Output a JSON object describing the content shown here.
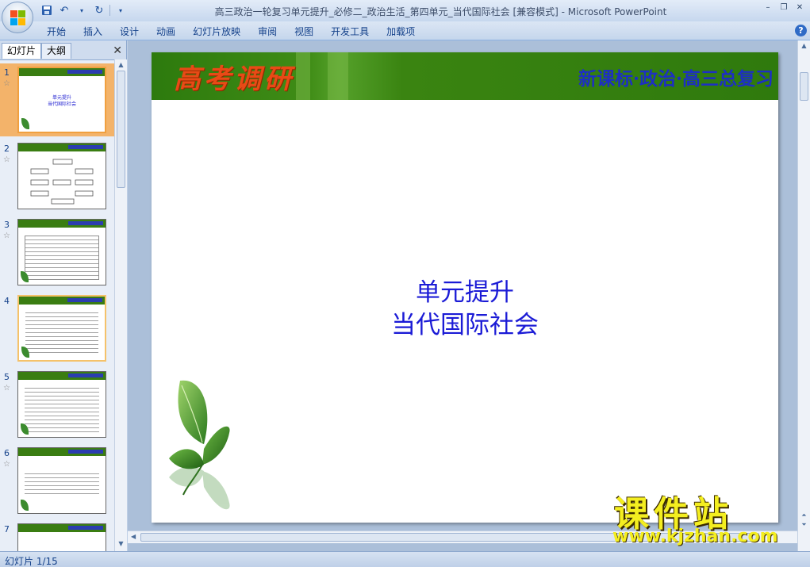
{
  "window": {
    "title": "高三政治一轮复习单元提升_必修二_政治生活_第四单元_当代国际社会 [兼容模式] - Microsoft PowerPoint",
    "minimize": "–",
    "restore": "❐",
    "close": "✕"
  },
  "qat": {
    "save_icon": "save-icon",
    "undo_icon": "undo-icon",
    "redo_icon": "redo-icon"
  },
  "ribbon": {
    "tabs": [
      "开始",
      "插入",
      "设计",
      "动画",
      "幻灯片放映",
      "审阅",
      "视图",
      "开发工具",
      "加载项"
    ],
    "help": "?"
  },
  "left_pane": {
    "tab_slides": "幻灯片",
    "tab_outline": "大纲",
    "close": "✕",
    "thumbnails": [
      {
        "num": "1",
        "star": "☆",
        "t1": "单元提升",
        "t2": "当代国际社会"
      },
      {
        "num": "2",
        "star": "☆"
      },
      {
        "num": "3",
        "star": "☆"
      },
      {
        "num": "4",
        "star": ""
      },
      {
        "num": "5",
        "star": "☆"
      },
      {
        "num": "6",
        "star": "☆"
      },
      {
        "num": "7",
        "star": ""
      }
    ]
  },
  "slide": {
    "banner_title": "高考调研",
    "banner_subtitle": "新课标·政治·高三总复习",
    "line1": "单元提升",
    "line2": "当代国际社会"
  },
  "watermark": {
    "text": "课件站",
    "url": "www.kjzhan.com"
  },
  "status": {
    "slide_counter": "幻灯片 1/15"
  },
  "colors": {
    "banner_green": "#3a7d12",
    "banner_title": "#e84a16",
    "banner_subtitle": "#1d2fc4",
    "slide_text": "#1b1bd6",
    "watermark": "#f4ee20"
  }
}
